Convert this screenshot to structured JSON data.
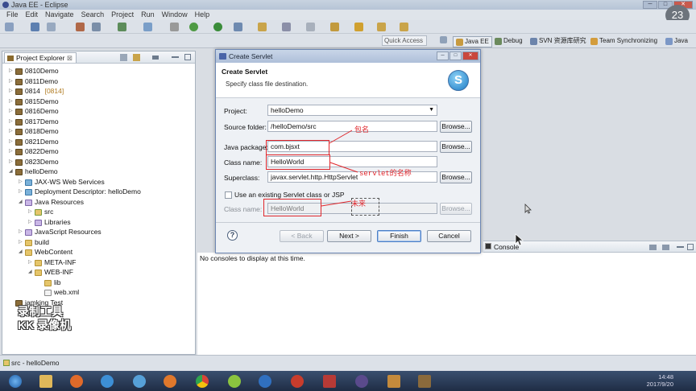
{
  "window": {
    "title": "Java EE - Eclipse",
    "controls": [
      "─",
      "□",
      "✕"
    ]
  },
  "menu": [
    "File",
    "Edit",
    "Navigate",
    "Search",
    "Project",
    "Run",
    "Window",
    "Help"
  ],
  "badge": "23",
  "perspectives": {
    "quick_access": "Quick Access",
    "items": [
      "Java EE",
      "Debug",
      "SVN 资源库研究",
      "Team Synchronizing",
      "Java"
    ]
  },
  "explorer": {
    "tab_label": "Project Explorer",
    "tab_close": "⊠",
    "items": [
      {
        "label": "0810Demo",
        "suffix": ""
      },
      {
        "label": "0811Demo",
        "suffix": ""
      },
      {
        "label": "0814",
        "suffix": "[0814]"
      },
      {
        "label": "0815Demo",
        "suffix": ""
      },
      {
        "label": "0816Demo",
        "suffix": ""
      },
      {
        "label": "0817Demo",
        "suffix": ""
      },
      {
        "label": "0818Demo",
        "suffix": ""
      },
      {
        "label": "0821Demo",
        "suffix": ""
      },
      {
        "label": "0822Demo",
        "suffix": ""
      },
      {
        "label": "0823Demo",
        "suffix": ""
      },
      {
        "label": "helloDemo",
        "suffix": ""
      },
      {
        "label": "JAX-WS Web Services",
        "suffix": ""
      },
      {
        "label": "Deployment Descriptor: helloDemo",
        "suffix": ""
      },
      {
        "label": "Java Resources",
        "suffix": ""
      },
      {
        "label": "src",
        "suffix": ""
      },
      {
        "label": "Libraries",
        "suffix": ""
      },
      {
        "label": "JavaScript Resources",
        "suffix": ""
      },
      {
        "label": "build",
        "suffix": ""
      },
      {
        "label": "WebContent",
        "suffix": ""
      },
      {
        "label": "META-INF",
        "suffix": ""
      },
      {
        "label": "WEB-INF",
        "suffix": ""
      },
      {
        "label": "lib",
        "suffix": ""
      },
      {
        "label": "web.xml",
        "suffix": ""
      },
      {
        "label": "jamking Test",
        "suffix": ""
      }
    ]
  },
  "console": {
    "tab_label": "Console",
    "message": "No consoles to display at this time."
  },
  "status_bar": {
    "text": "src - helloDemo"
  },
  "taskbar": {
    "time": "14:48",
    "date": "2017/9/20"
  },
  "watermark": {
    "line1": "录制工具",
    "line2": "KK 录像机"
  },
  "dialog": {
    "title": "Create Servlet",
    "heading": "Create Servlet",
    "subheading": "Specify class file destination.",
    "logo_letter": "S",
    "labels": {
      "project": "Project:",
      "source_folder": "Source folder:",
      "java_package": "Java package:",
      "class_name": "Class name:",
      "superclass": "Superclass:",
      "use_existing": "Use an existing Servlet class or JSP",
      "existing_class_name": "Class name:"
    },
    "values": {
      "project": "helloDemo",
      "source_folder": "/helloDemo/src",
      "java_package": "com.bjsxt",
      "class_name": "HelloWorld",
      "superclass": "javax.servlet.http.HttpServlet",
      "existing_class_name": "HelloWorld"
    },
    "buttons": {
      "browse": "Browse...",
      "back": "< Back",
      "next": "Next >",
      "finish": "Finish",
      "cancel": "Cancel",
      "help": "?"
    },
    "annotations": {
      "package_note": "包名",
      "servlet_note": "servlet的名称",
      "future_note": "未来"
    }
  }
}
